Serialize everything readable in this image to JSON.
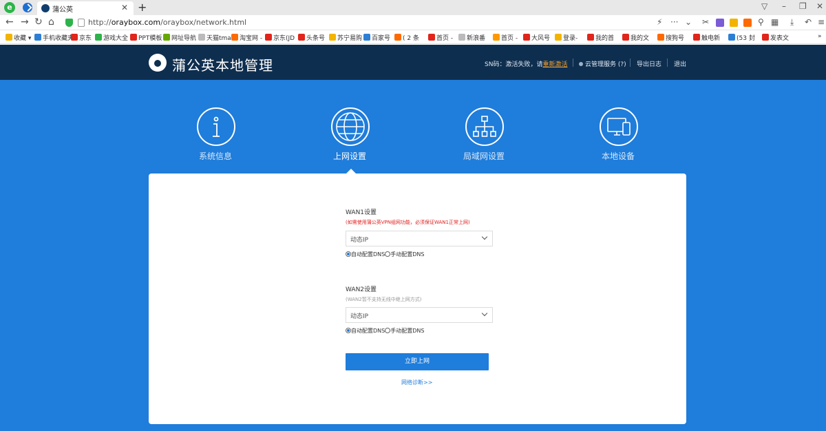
{
  "browser": {
    "tab_title": "蒲公英",
    "url_prefix": "http://",
    "url_domain": "oraybox.com",
    "url_path": "/oraybox/network.html"
  },
  "bookmarks": [
    {
      "label": "收藏",
      "color": "#f3b400"
    },
    {
      "label": "手机收藏夹",
      "color": "#2d7fd6"
    },
    {
      "label": "京东",
      "color": "#e1251b"
    },
    {
      "label": "游戏大全",
      "color": "#2eb34a"
    },
    {
      "label": "PPT模板",
      "color": "#e1251b"
    },
    {
      "label": "网址导航",
      "color": "#66a800"
    },
    {
      "label": "天猫tmall",
      "color": "#bbbbbb"
    },
    {
      "label": "淘宝网 -",
      "color": "#ff6a00"
    },
    {
      "label": "京东(JD",
      "color": "#e1251b"
    },
    {
      "label": "头条号",
      "color": "#e1251b"
    },
    {
      "label": "苏宁易购",
      "color": "#f3b400"
    },
    {
      "label": "百家号",
      "color": "#2d7fd6"
    },
    {
      "label": "( 2 条",
      "color": "#ff6a00"
    },
    {
      "label": "首页 -",
      "color": "#e1251b"
    },
    {
      "label": "新浪番",
      "color": "#bbbbbb"
    },
    {
      "label": "首页 -",
      "color": "#ff9900"
    },
    {
      "label": "大风号",
      "color": "#e1251b"
    },
    {
      "label": "登录-",
      "color": "#f3b400"
    },
    {
      "label": "我的首",
      "color": "#e1251b"
    },
    {
      "label": "我的文",
      "color": "#e1251b"
    },
    {
      "label": "搜狗号",
      "color": "#ff6a00"
    },
    {
      "label": "触电新",
      "color": "#e1251b"
    },
    {
      "label": "(53 封",
      "color": "#2d7fd6"
    },
    {
      "label": "发表文",
      "color": "#e1251b"
    }
  ],
  "header": {
    "brand": "蒲公英本地管理",
    "sn_text": "SN码：激活失败，请",
    "reactivate": "重新激活",
    "cloud_service": "云管理服务 (?)",
    "export_log": "导出日志",
    "logout": "退出"
  },
  "nav": [
    {
      "label": "系统信息",
      "icon": "info-icon"
    },
    {
      "label": "上网设置",
      "icon": "globe-icon"
    },
    {
      "label": "局域网设置",
      "icon": "network-icon"
    },
    {
      "label": "本地设备",
      "icon": "devices-icon"
    }
  ],
  "wan1": {
    "title": "WAN1设置",
    "warning": "(如需使用蒲公英VPN组网功能，必须保证WAN1正常上网)",
    "mode": "动态IP",
    "dns_auto": "自动配置DNS",
    "dns_manual": "手动配置DNS"
  },
  "wan2": {
    "title": "WAN2设置",
    "note": "(WAN2暂不支持无线中继上网方式)",
    "mode": "动态IP",
    "dns_auto": "自动配置DNS",
    "dns_manual": "手动配置DNS"
  },
  "actions": {
    "submit": "立即上网",
    "diagnose": "网络诊断>>"
  }
}
